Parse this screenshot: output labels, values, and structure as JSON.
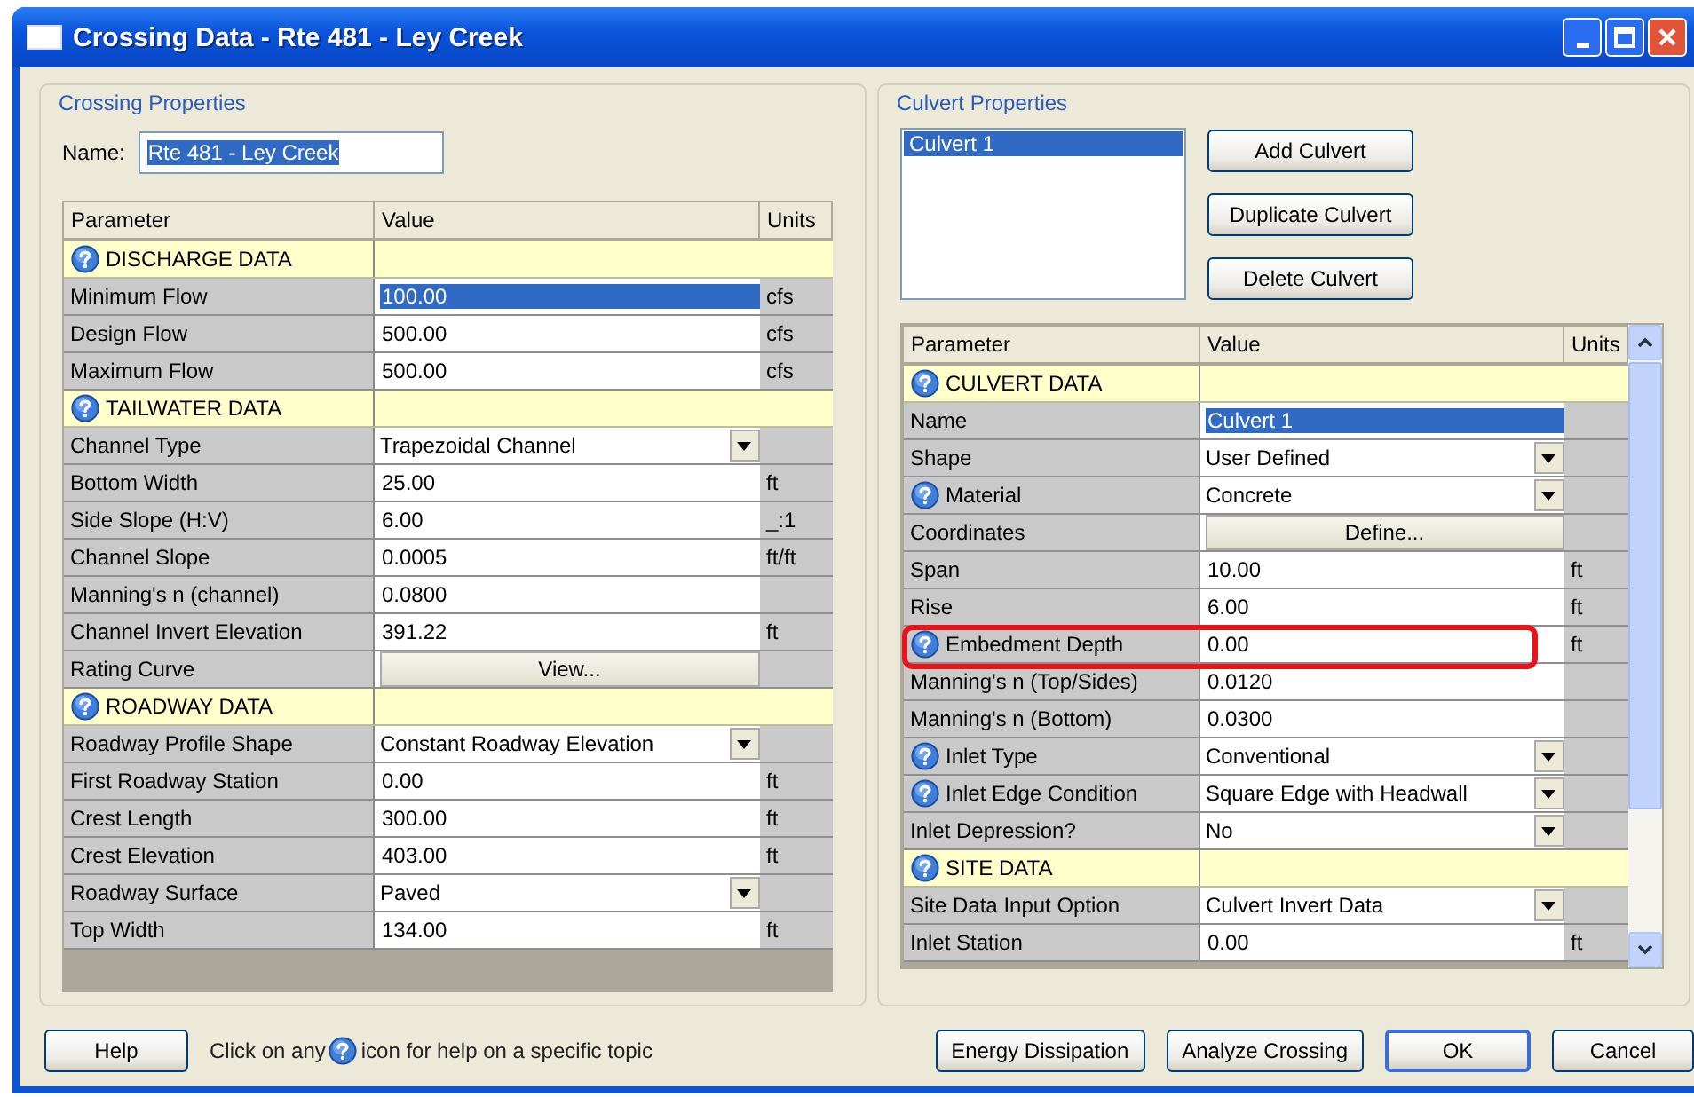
{
  "window": {
    "title": "Crossing Data - Rte 481 - Ley Creek"
  },
  "crossing_properties": {
    "title": "Crossing Properties",
    "name_label": "Name:",
    "name_value": "Rte 481 - Ley Creek",
    "name_selected": true,
    "table": {
      "columns": [
        "Parameter",
        "Value",
        "Units"
      ],
      "rows": [
        {
          "kind": "section",
          "label": "DISCHARGE DATA"
        },
        {
          "kind": "text",
          "label": "Minimum Flow",
          "value": "100.00",
          "units": "cfs",
          "selected": true
        },
        {
          "kind": "text",
          "label": "Design Flow",
          "value": "500.00",
          "units": "cfs",
          "selected": false
        },
        {
          "kind": "text",
          "label": "Maximum Flow",
          "value": "500.00",
          "units": "cfs",
          "selected": false
        },
        {
          "kind": "section",
          "label": "TAILWATER DATA"
        },
        {
          "kind": "dropdown",
          "label": "Channel Type",
          "value": "Trapezoidal Channel"
        },
        {
          "kind": "text",
          "label": "Bottom Width",
          "value": "25.00",
          "units": "ft",
          "selected": false
        },
        {
          "kind": "text",
          "label": "Side Slope (H:V)",
          "value": "6.00",
          "units": "_:1",
          "selected": false
        },
        {
          "kind": "text",
          "label": "Channel Slope",
          "value": "0.0005",
          "units": "ft/ft",
          "selected": false
        },
        {
          "kind": "text",
          "label": "Manning's n (channel)",
          "value": "0.0800",
          "selected": false
        },
        {
          "kind": "text",
          "label": "Channel Invert Elevation",
          "value": "391.22",
          "units": "ft",
          "selected": false
        },
        {
          "kind": "button",
          "label": "Rating Curve",
          "value": "View..."
        },
        {
          "kind": "section",
          "label": "ROADWAY DATA"
        },
        {
          "kind": "dropdown",
          "label": "Roadway Profile Shape",
          "value": "Constant Roadway Elevation"
        },
        {
          "kind": "text",
          "label": "First Roadway Station",
          "value": "0.00",
          "units": "ft",
          "selected": false
        },
        {
          "kind": "text",
          "label": "Crest Length",
          "value": "300.00",
          "units": "ft",
          "selected": false
        },
        {
          "kind": "text",
          "label": "Crest Elevation",
          "value": "403.00",
          "units": "ft",
          "selected": false
        },
        {
          "kind": "dropdown",
          "label": "Roadway Surface",
          "value": "Paved"
        },
        {
          "kind": "text",
          "label": "Top Width",
          "value": "134.00",
          "units": "ft",
          "selected": false
        }
      ]
    }
  },
  "culvert_properties": {
    "title": "Culvert Properties",
    "culverts": [
      {
        "label": "Culvert 1",
        "selected": true
      }
    ],
    "buttons": [
      "Add Culvert",
      "Duplicate Culvert",
      "Delete Culvert"
    ],
    "table": {
      "columns": [
        "Parameter",
        "Value",
        "Units"
      ],
      "rows": [
        {
          "kind": "section",
          "label": "CULVERT DATA"
        },
        {
          "kind": "text",
          "label": "Name",
          "value": "Culvert 1",
          "selected": true
        },
        {
          "kind": "dropdown",
          "label": "Shape",
          "value": "User Defined"
        },
        {
          "kind": "dropdown",
          "label": "Material",
          "value": "Concrete",
          "help": true
        },
        {
          "kind": "button",
          "label": "Coordinates",
          "value": "Define..."
        },
        {
          "kind": "text",
          "label": "Span",
          "value": "10.00",
          "units": "ft",
          "selected": false
        },
        {
          "kind": "text",
          "label": "Rise",
          "value": "6.00",
          "units": "ft",
          "selected": false
        },
        {
          "kind": "text",
          "label": "Embedment Depth",
          "value": "0.00",
          "units": "ft",
          "selected": false,
          "help": true,
          "highlighted": true
        },
        {
          "kind": "text",
          "label": "Manning's n (Top/Sides)",
          "value": "0.0120",
          "selected": false
        },
        {
          "kind": "text",
          "label": "Manning's n (Bottom)",
          "value": "0.0300",
          "selected": false
        },
        {
          "kind": "dropdown",
          "label": "Inlet Type",
          "value": "Conventional",
          "help": true
        },
        {
          "kind": "dropdown",
          "label": "Inlet Edge Condition",
          "value": "Square Edge with Headwall",
          "help": true
        },
        {
          "kind": "dropdown",
          "label": "Inlet Depression?",
          "value": "No"
        },
        {
          "kind": "section",
          "label": "SITE DATA"
        },
        {
          "kind": "dropdown",
          "label": "Site Data Input Option",
          "value": "Culvert Invert Data"
        },
        {
          "kind": "text",
          "label": "Inlet Station",
          "value": "0.00",
          "units": "ft",
          "selected": false
        }
      ]
    }
  },
  "footer": {
    "help_button": "Help",
    "hint_before": "Click on any",
    "hint_after": "icon for help on a specific topic",
    "buttons": [
      {
        "label": "Energy Dissipation",
        "default": false
      },
      {
        "label": "Analyze Crossing",
        "default": false
      },
      {
        "label": "OK",
        "default": true
      },
      {
        "label": "Cancel",
        "default": false
      }
    ]
  }
}
